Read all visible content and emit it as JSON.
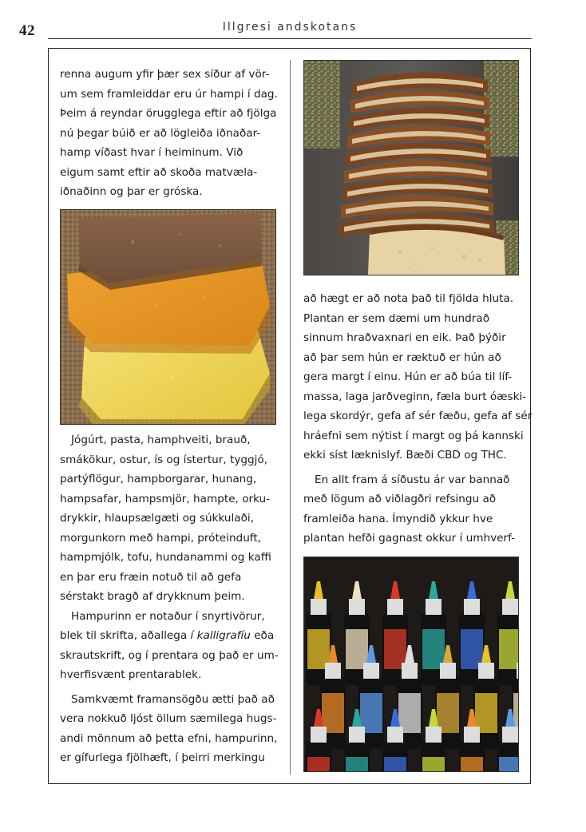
{
  "header": {
    "page_number": "42",
    "running_title": "Illgresi andskotans"
  },
  "left_column": {
    "top_lines": [
      "renna augum yfir þær sex síður af vör-",
      "um sem framleiddar eru úr hampi í dag.",
      "Þeim á reyndar örugglega eftir að fjölga",
      "nú þegar búið er að lögleiða iðnaðar-",
      "hamp víðast hvar í heiminum. Við",
      "eigum samt eftir að skoða matvæla-",
      "iðnaðinn og þar er gróska."
    ],
    "paragraph_products": [
      "Jógúrt, pasta, hamphveiti, brauð,",
      "smákökur, ostur, ís og ístertur, tyggjó,",
      "partýflögur, hampborgarar, hunang,",
      "hampsafar, hampsmjör, hampte, orku-",
      "drykkir, hlaupsælgæti og súkkulaði,",
      "morgunkorn með hampi, próteinduft,",
      "hampmjólk, tofu, hundanammi og kaffi",
      "en þar eru fræin notuð til að gefa",
      "sérstakt bragð af drykknum þeim."
    ],
    "paragraph_ink": {
      "line1": "Hampurinn er notaður í snyrtivörur,",
      "line2_before": "blek til skrifta, aðallega ",
      "line2_italic": "í kalligrafíu",
      "line2_after": " eða",
      "line3": "skrautskrift, og í prentara og það er um-",
      "line4": "hverfisvænt prentarablek."
    },
    "paragraph_versatile": [
      "Samkvæmt framansögðu ætti það að",
      "vera nokkuð ljóst öllum sæmilega hugs-",
      "andi mönnum að þetta efni, hampurinn,",
      "er gífurlega fjölhæft, í þeirri merkingu"
    ]
  },
  "right_column": {
    "paragraph_plant": [
      "að hægt er að nota það til fjölda hluta.",
      "Plantan er sem dæmi um hundrað",
      "sinnum hraðvaxnari en eik. Það þýðir",
      "að þar sem hún er ræktuð er hún að",
      "gera margt í einu. Hún er að búa til líf-",
      "massa, laga jarðveginn, fæla burt óæski-",
      "lega skordýr, gefa af sér fæðu, gefa af sér",
      "hráefni sem nýtist í margt og þá kannski",
      "ekki síst læknislyf. Bæði CBD og THC."
    ],
    "paragraph_ban": [
      "En allt fram á síðustu ár var bannað",
      "með lögum að viðlagðri refsingu að",
      "framleiða hana. Ímyndið ykkur hve",
      "plantan hefði gagnast okkur í umhverf-"
    ]
  },
  "photos": {
    "soap": "hemp-soap-bars-photo",
    "bread": "sliced-hemp-bread-photo",
    "ink": "ink-bottles-photo"
  },
  "colors": {
    "rule": "#222222",
    "column_rule": "#777777"
  }
}
